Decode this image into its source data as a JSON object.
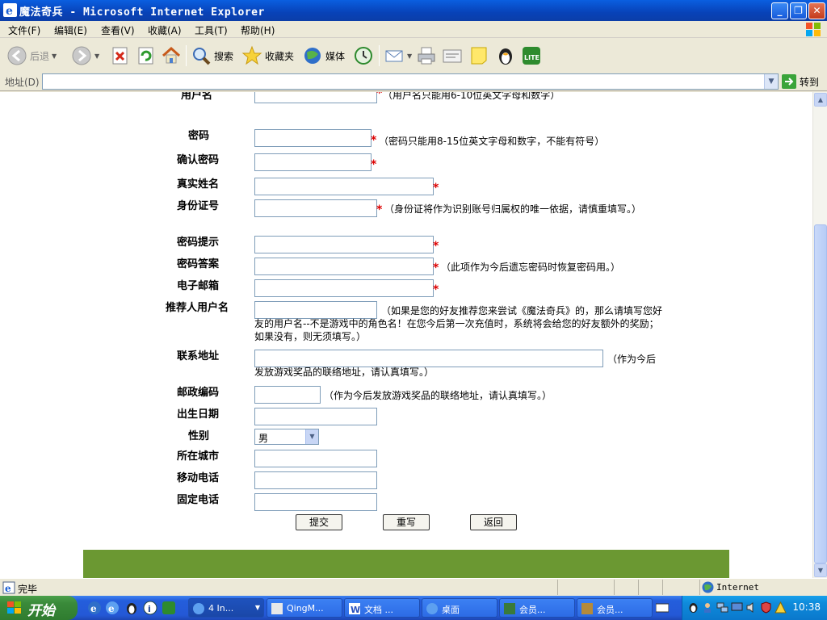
{
  "window": {
    "title": "魔法奇兵 - Microsoft Internet Explorer"
  },
  "menubar": {
    "items": [
      "文件(F)",
      "编辑(E)",
      "查看(V)",
      "收藏(A)",
      "工具(T)",
      "帮助(H)"
    ]
  },
  "toolbar": {
    "back": "后退",
    "search": "搜索",
    "favorites": "收藏夹",
    "media": "媒体"
  },
  "address": {
    "label": "地址(D)",
    "value": "",
    "go": "转到"
  },
  "form": {
    "username_label": "用户名",
    "username_note": "（用户名只能用6-10位英文字母和数字）",
    "password_label": "密码",
    "password_note": "（密码只能用8-15位英文字母和数字，不能有符号）",
    "confirm_label": "确认密码",
    "realname_label": "真实姓名",
    "idcard_label": "身份证号",
    "idcard_note": "（身份证将作为识别账号归属权的唯一依据，请慎重填写。）",
    "hint_label": "密码提示",
    "answer_label": "密码答案",
    "answer_note": "（此项作为今后遗忘密码时恢复密码用。）",
    "email_label": "电子邮箱",
    "referrer_label": "推荐人用户名",
    "referrer_note": "（如果是您的好友推荐您来尝试《魔法奇兵》的，那么请填写您好友的用户名--不是游戏中的角色名！在您今后第一次充值时，系统将会给您的好友额外的奖励；如果没有，则无须填写。）",
    "address_label": "联系地址",
    "address_note": "（作为今后发放游戏奖品的联络地址，请认真填写。）",
    "postcode_label": "邮政编码",
    "postcode_note": "（作为今后发放游戏奖品的联络地址，请认真填写。）",
    "birthday_label": "出生日期",
    "gender_label": "性别",
    "gender_value": "男",
    "city_label": "所在城市",
    "mobile_label": "移动电话",
    "phone_label": "固定电话",
    "required_mark": "*",
    "submit": "提交",
    "reset": "重写",
    "back": "返回"
  },
  "status": {
    "text": "完毕",
    "zone": "Internet"
  },
  "taskbar": {
    "start": "开始",
    "tasks": [
      "4 In...",
      "QingM...",
      "文档 ...",
      "桌面",
      "会员...",
      "会员..."
    ],
    "clock": "10:38"
  },
  "colors": {
    "title_bar": "#0842B8",
    "footer_band": "#6B9832",
    "required": "#DD0000"
  }
}
